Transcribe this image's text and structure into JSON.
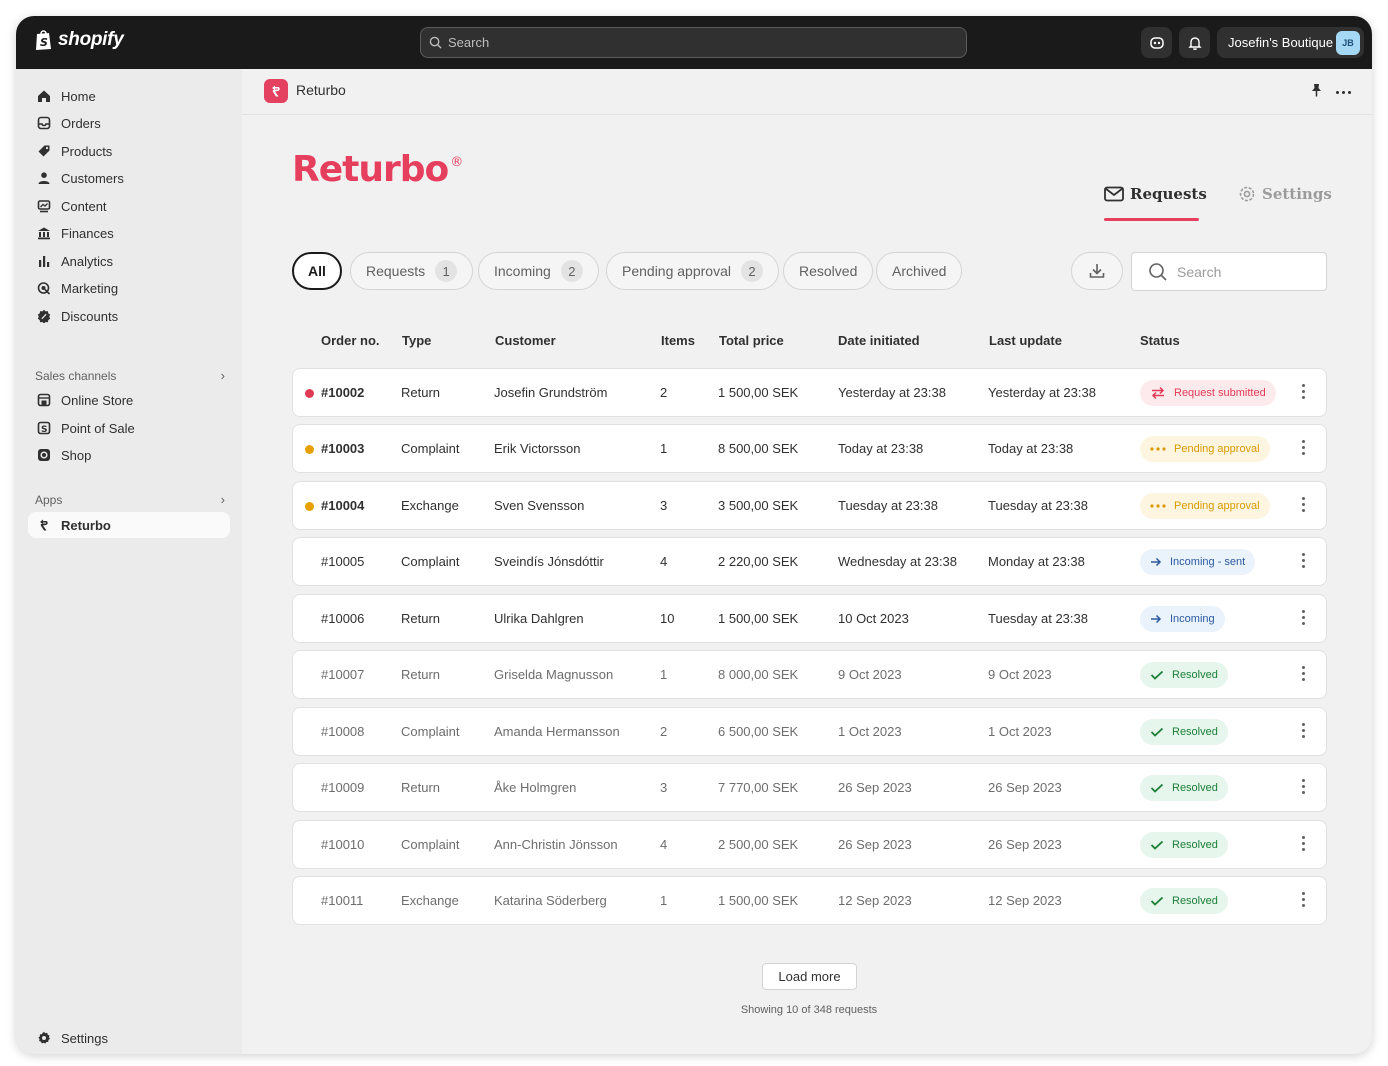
{
  "topbar": {
    "logo_text": "shopify",
    "search_placeholder": "Search",
    "store_name": "Josefin's Boutique",
    "avatar_initials": "JB"
  },
  "sidebar": {
    "items": [
      {
        "label": "Home",
        "icon": "home-icon"
      },
      {
        "label": "Orders",
        "icon": "orders-icon"
      },
      {
        "label": "Products",
        "icon": "tag-icon"
      },
      {
        "label": "Customers",
        "icon": "person-icon"
      },
      {
        "label": "Content",
        "icon": "content-icon"
      },
      {
        "label": "Finances",
        "icon": "bank-icon"
      },
      {
        "label": "Analytics",
        "icon": "bar-chart-icon"
      },
      {
        "label": "Marketing",
        "icon": "target-icon"
      },
      {
        "label": "Discounts",
        "icon": "discount-icon"
      }
    ],
    "sales_channels_label": "Sales channels",
    "channels": [
      {
        "label": "Online Store",
        "icon": "store-icon"
      },
      {
        "label": "Point of Sale",
        "icon": "pos-icon"
      },
      {
        "label": "Shop",
        "icon": "shop-icon"
      }
    ],
    "apps_label": "Apps",
    "apps": [
      {
        "label": "Returbo",
        "icon": "returbo-icon"
      }
    ],
    "settings_label": "Settings"
  },
  "app_header": {
    "title": "Returbo"
  },
  "brand": {
    "name": "Returbo",
    "mark": "®"
  },
  "tabs": {
    "requests": "Requests",
    "settings": "Settings"
  },
  "filters": [
    {
      "label": "All",
      "count": null
    },
    {
      "label": "Requests",
      "count": "1"
    },
    {
      "label": "Incoming",
      "count": "2"
    },
    {
      "label": "Pending approval",
      "count": "2"
    },
    {
      "label": "Resolved",
      "count": null
    },
    {
      "label": "Archived",
      "count": null
    }
  ],
  "search_placeholder": "Search",
  "table": {
    "headers": [
      "Order no.",
      "Type",
      "Customer",
      "Items",
      "Total price",
      "Date initiated",
      "Last update",
      "Status"
    ],
    "rows": [
      {
        "order": "#10002",
        "type": "Return",
        "customer": "Josefin Grundström",
        "items": "2",
        "price": "1 500,00 SEK",
        "initiated": "Yesterday at 23:38",
        "updated": "Yesterday at 23:38",
        "status": "Request submitted",
        "status_kind": "red",
        "dot": "#e03a57",
        "muted": false
      },
      {
        "order": "#10003",
        "type": "Complaint",
        "customer": "Erik Victorsson",
        "items": "1",
        "price": "8 500,00 SEK",
        "initiated": "Today at 23:38",
        "updated": "Today at 23:38",
        "status": "Pending approval",
        "status_kind": "yellow",
        "dot": "#e6a100",
        "muted": false
      },
      {
        "order": "#10004",
        "type": "Exchange",
        "customer": "Sven Svensson",
        "items": "3",
        "price": "3 500,00 SEK",
        "initiated": "Tuesday at 23:38",
        "updated": "Tuesday at 23:38",
        "status": "Pending approval",
        "status_kind": "yellow",
        "dot": "#e6a100",
        "muted": false
      },
      {
        "order": "#10005",
        "type": "Complaint",
        "customer": "Sveindís Jónsdóttir",
        "items": "4",
        "price": "2 220,00 SEK",
        "initiated": "Wednesday at 23:38",
        "updated": "Monday at 23:38",
        "status": "Incoming - sent",
        "status_kind": "blue",
        "dot": null,
        "muted": false
      },
      {
        "order": "#10006",
        "type": "Return",
        "customer": "Ulrika Dahlgren",
        "items": "10",
        "price": "1 500,00 SEK",
        "initiated": "10 Oct 2023",
        "updated": "Tuesday at 23:38",
        "status": "Incoming",
        "status_kind": "blue",
        "dot": null,
        "muted": false
      },
      {
        "order": "#10007",
        "type": "Return",
        "customer": "Griselda Magnusson",
        "items": "1",
        "price": "8 000,00 SEK",
        "initiated": "9 Oct 2023",
        "updated": "9 Oct 2023",
        "status": "Resolved",
        "status_kind": "green",
        "dot": null,
        "muted": true
      },
      {
        "order": "#10008",
        "type": "Complaint",
        "customer": "Amanda Hermansson",
        "items": "2",
        "price": "6 500,00 SEK",
        "initiated": "1 Oct 2023",
        "updated": "1 Oct 2023",
        "status": "Resolved",
        "status_kind": "green",
        "dot": null,
        "muted": true
      },
      {
        "order": "#10009",
        "type": "Return",
        "customer": "Åke Holmgren",
        "items": "3",
        "price": "7 770,00 SEK",
        "initiated": "26 Sep 2023",
        "updated": "26 Sep 2023",
        "status": "Resolved",
        "status_kind": "green",
        "dot": null,
        "muted": true
      },
      {
        "order": "#10010",
        "type": "Complaint",
        "customer": "Ann-Christin Jönsson",
        "items": "4",
        "price": "2 500,00 SEK",
        "initiated": "26 Sep 2023",
        "updated": "26 Sep 2023",
        "status": "Resolved",
        "status_kind": "green",
        "dot": null,
        "muted": true
      },
      {
        "order": "#10011",
        "type": "Exchange",
        "customer": "Katarina Söderberg",
        "items": "1",
        "price": "1 500,00 SEK",
        "initiated": "12 Sep 2023",
        "updated": "12 Sep 2023",
        "status": "Resolved",
        "status_kind": "green",
        "dot": null,
        "muted": true
      }
    ]
  },
  "load_more_label": "Load more",
  "showing_text": "Showing 10 of 348 requests",
  "colors": {
    "accent": "#e63f5e",
    "topbar": "#1a1a1a"
  }
}
